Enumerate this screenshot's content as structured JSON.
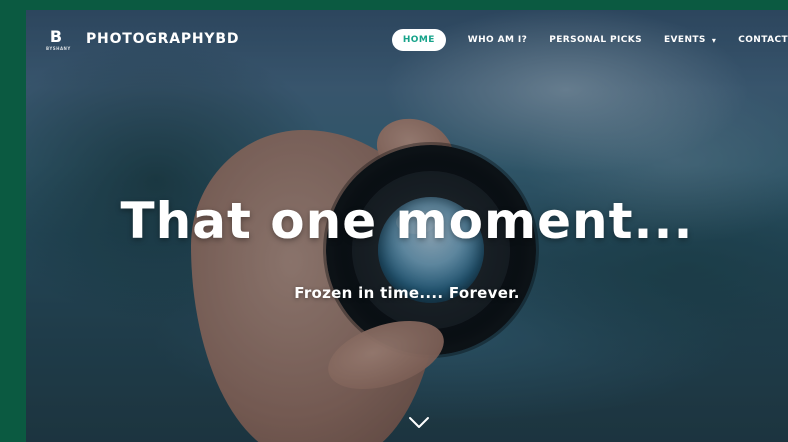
{
  "nav": {
    "logo_letter": "B",
    "logo_caption": "BYSHANY",
    "brand": "PHOTOGRAPHYBD",
    "items": [
      {
        "label": "HOME",
        "active": true
      },
      {
        "label": "WHO AM I?",
        "active": false
      },
      {
        "label": "PERSONAL PICKS",
        "active": false
      },
      {
        "label": "EVENTS",
        "active": false,
        "dropdown": true
      },
      {
        "label": "CONTACT",
        "active": false
      }
    ],
    "dropdown_caret": "▾"
  },
  "hero": {
    "headline": "That one moment...",
    "subline": "Frozen in time.... Forever."
  },
  "icons": {
    "scroll": "chevron-down-icon"
  },
  "colors": {
    "page_border": "#0b5a41",
    "accent": "#17a38a",
    "text": "#ffffff"
  }
}
